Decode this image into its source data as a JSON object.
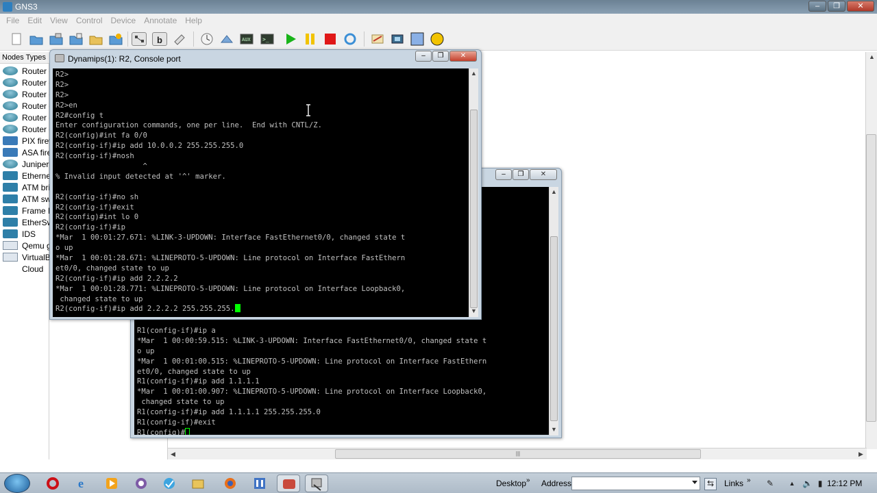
{
  "app": {
    "title": "GNS3"
  },
  "menu": [
    "File",
    "Edit",
    "View",
    "Control",
    "Device",
    "Annotate",
    "Help"
  ],
  "nodes_panel": {
    "header": "Nodes Types",
    "items": [
      {
        "label": "Router c",
        "icon": "router-icon"
      },
      {
        "label": "Router c",
        "icon": "router-icon"
      },
      {
        "label": "Router c",
        "icon": "router-icon"
      },
      {
        "label": "Router c",
        "icon": "router-icon"
      },
      {
        "label": "Router c",
        "icon": "router-icon"
      },
      {
        "label": "Router c",
        "icon": "router-icon"
      },
      {
        "label": "PIX firew",
        "icon": "firewall-icon"
      },
      {
        "label": "ASA firew",
        "icon": "firewall-icon"
      },
      {
        "label": "Juniper",
        "icon": "router-icon"
      },
      {
        "label": "Etherne",
        "icon": "ethernet-switch-icon"
      },
      {
        "label": "ATM bri",
        "icon": "atm-bridge-icon"
      },
      {
        "label": "ATM sw",
        "icon": "atm-switch-icon"
      },
      {
        "label": "Frame R",
        "icon": "frame-relay-icon"
      },
      {
        "label": "EtherSw",
        "icon": "etherswitch-icon"
      },
      {
        "label": "IDS",
        "icon": "ids-icon"
      },
      {
        "label": "Qemu g",
        "icon": "pc-icon"
      },
      {
        "label": "VirtualB",
        "icon": "pc-icon"
      },
      {
        "label": "Cloud",
        "icon": "cloud-icon"
      }
    ]
  },
  "console_r2": {
    "title": "Dynamips(1): R2, Console port",
    "lines": [
      "R2>",
      "R2>",
      "R2>",
      "R2>en",
      "R2#config t",
      "Enter configuration commands, one per line.  End with CNTL/Z.",
      "R2(config)#int fa 0/0",
      "R2(config-if)#ip add 10.0.0.2 255.255.255.0",
      "R2(config-if)#nosh",
      "                    ^",
      "% Invalid input detected at '^' marker.",
      "",
      "R2(config-if)#no sh",
      "R2(config-if)#exit",
      "R2(config)#int lo 0",
      "R2(config-if)#ip",
      "*Mar  1 00:01:27.671: %LINK-3-UPDOWN: Interface FastEthernet0/0, changed state t",
      "o up",
      "*Mar  1 00:01:28.671: %LINEPROTO-5-UPDOWN: Line protocol on Interface FastEthern",
      "et0/0, changed state to up",
      "R2(config-if)#ip add 2.2.2.2",
      "*Mar  1 00:01:28.771: %LINEPROTO-5-UPDOWN: Line protocol on Interface Loopback0,",
      " changed state to up"
    ],
    "prompt_line": "R2(config-if)#ip add 2.2.2.2 255.255.255."
  },
  "console_r1": {
    "lines": [
      "R1(config-if)#ip a",
      "*Mar  1 00:00:59.515: %LINK-3-UPDOWN: Interface FastEthernet0/0, changed state t",
      "o up",
      "*Mar  1 00:01:00.515: %LINEPROTO-5-UPDOWN: Line protocol on Interface FastEthern",
      "et0/0, changed state to up",
      "R1(config-if)#ip add 1.1.1.1",
      "*Mar  1 00:01:00.907: %LINEPROTO-5-UPDOWN: Line protocol on Interface Loopback0,",
      " changed state to up",
      "R1(config-if)#ip add 1.1.1.1 255.255.255.0",
      "R1(config-if)#exit"
    ],
    "prompt_line": "R1(config)#"
  },
  "taskbar": {
    "desktop": "Desktop",
    "address": "Address",
    "address_value": "",
    "links": "Links",
    "chevron": "»",
    "time": "12:12 PM"
  }
}
